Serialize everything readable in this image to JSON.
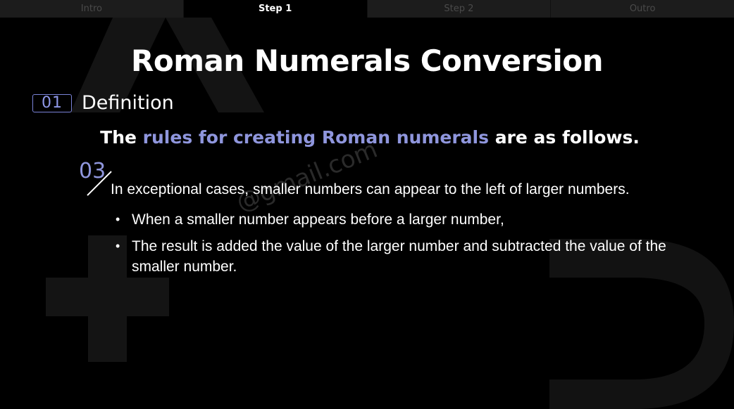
{
  "tabs": [
    {
      "label": "Intro",
      "active": false
    },
    {
      "label": "Step 1",
      "active": true
    },
    {
      "label": "Step 2",
      "active": false
    },
    {
      "label": "Outro",
      "active": false
    }
  ],
  "title": "Roman Numerals Conversion",
  "section": {
    "number": "01",
    "title": "Definition"
  },
  "lead": {
    "prefix": "The ",
    "highlight": "rules for creating Roman numerals",
    "suffix": " are as follows."
  },
  "step_number": "03",
  "main_text": "In exceptional cases, smaller numbers can appear to the left of larger numbers.",
  "bullets": [
    "When a smaller number appears before a larger number,",
    "The result is added the value of the larger number and subtracted the value of the smaller number."
  ],
  "bullet_glyph": "•",
  "colors": {
    "accent": "#8f96dd",
    "background": "#000000",
    "tab_bar": "#1c1c1c"
  }
}
